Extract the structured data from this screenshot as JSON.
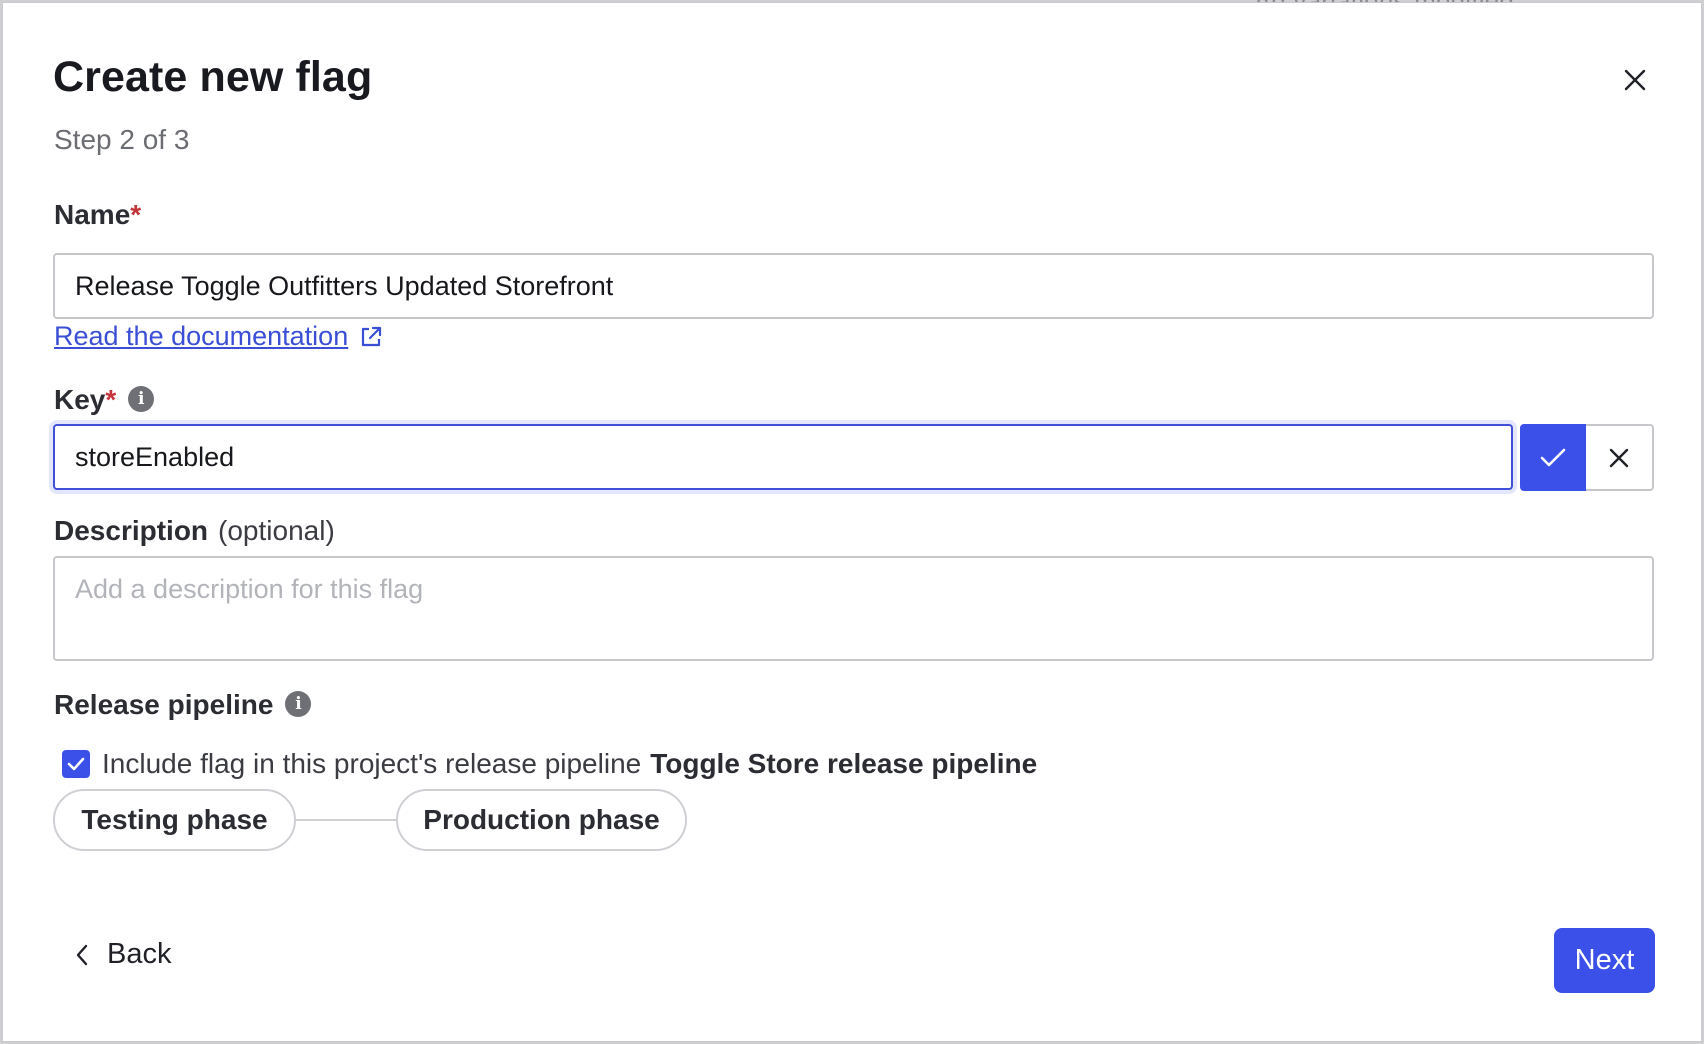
{
  "background": {
    "peek_text": "Ad variations modified"
  },
  "dialog": {
    "title": "Create new flag",
    "step": "Step 2 of 3",
    "close_icon": "close-icon"
  },
  "name_field": {
    "label": "Name",
    "required_mark": "*",
    "value": "Release Toggle Outfitters Updated Storefront"
  },
  "doc_link": {
    "label": "Read the documentation",
    "icon": "external-link-icon"
  },
  "key_field": {
    "label": "Key",
    "required_mark": "*",
    "info_glyph": "i",
    "value": "storeEnabled",
    "confirm_icon": "check-icon",
    "cancel_icon": "close-icon"
  },
  "description_field": {
    "label": "Description",
    "optional_text": "(optional)",
    "placeholder": "Add a description for this flag"
  },
  "release_pipeline": {
    "label": "Release pipeline",
    "info_glyph": "i",
    "checkbox_checked": true,
    "checkbox_text": "Include flag in this project's release pipeline",
    "pipeline_name": "Toggle Store release pipeline",
    "phases": [
      "Testing phase",
      "Production phase"
    ]
  },
  "footer": {
    "back_label": "Back",
    "next_label": "Next"
  },
  "colors": {
    "accent": "#3a50e8",
    "required": "#c4343a",
    "link": "#3b4fd6"
  }
}
